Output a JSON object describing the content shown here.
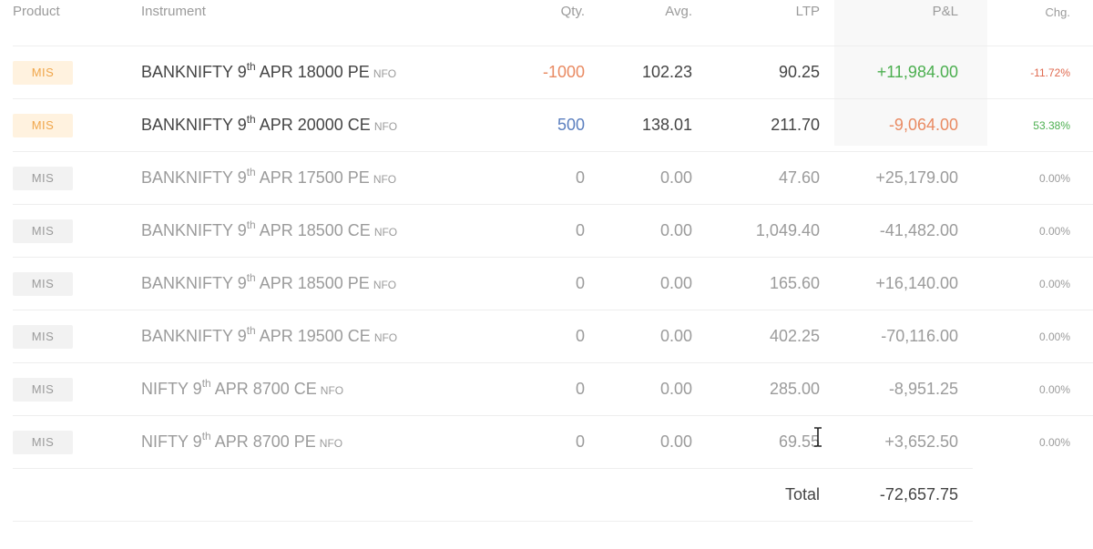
{
  "header": {
    "product": "Product",
    "instrument": "Instrument",
    "qty": "Qty.",
    "avg": "Avg.",
    "ltp": "LTP",
    "pl": "P&L",
    "chg": "Chg."
  },
  "rows": [
    {
      "product": "MIS",
      "inst_pre": "BANKNIFTY 9",
      "inst_sup": "th",
      "inst_post": " APR 18000 PE",
      "exchange": "NFO",
      "qty": "-1000",
      "avg": "102.23",
      "ltp": "90.25",
      "pl": "+11,984.00",
      "chg": "-11.72%"
    },
    {
      "product": "MIS",
      "inst_pre": "BANKNIFTY 9",
      "inst_sup": "th",
      "inst_post": " APR 20000 CE",
      "exchange": "NFO",
      "qty": "500",
      "avg": "138.01",
      "ltp": "211.70",
      "pl": "-9,064.00",
      "chg": "53.38%"
    },
    {
      "product": "MIS",
      "inst_pre": "BANKNIFTY 9",
      "inst_sup": "th",
      "inst_post": " APR 17500 PE",
      "exchange": "NFO",
      "qty": "0",
      "avg": "0.00",
      "ltp": "47.60",
      "pl": "+25,179.00",
      "chg": "0.00%"
    },
    {
      "product": "MIS",
      "inst_pre": "BANKNIFTY 9",
      "inst_sup": "th",
      "inst_post": " APR 18500 CE",
      "exchange": "NFO",
      "qty": "0",
      "avg": "0.00",
      "ltp": "1,049.40",
      "pl": "-41,482.00",
      "chg": "0.00%"
    },
    {
      "product": "MIS",
      "inst_pre": "BANKNIFTY 9",
      "inst_sup": "th",
      "inst_post": " APR 18500 PE",
      "exchange": "NFO",
      "qty": "0",
      "avg": "0.00",
      "ltp": "165.60",
      "pl": "+16,140.00",
      "chg": "0.00%"
    },
    {
      "product": "MIS",
      "inst_pre": "BANKNIFTY 9",
      "inst_sup": "th",
      "inst_post": " APR 19500 CE",
      "exchange": "NFO",
      "qty": "0",
      "avg": "0.00",
      "ltp": "402.25",
      "pl": "-70,116.00",
      "chg": "0.00%"
    },
    {
      "product": "MIS",
      "inst_pre": "NIFTY 9",
      "inst_sup": "th",
      "inst_post": " APR 8700 CE",
      "exchange": "NFO",
      "qty": "0",
      "avg": "0.00",
      "ltp": "285.00",
      "pl": "-8,951.25",
      "chg": "0.00%"
    },
    {
      "product": "MIS",
      "inst_pre": "NIFTY 9",
      "inst_sup": "th",
      "inst_post": " APR 8700 PE",
      "exchange": "NFO",
      "qty": "0",
      "avg": "0.00",
      "ltp": "69.55",
      "pl": "+3,652.50",
      "chg": "0.00%"
    }
  ],
  "footer": {
    "total_label": "Total",
    "total_value": "-72,657.75"
  },
  "colors": {
    "profit": "#4caf50",
    "loss": "#e98a62",
    "badge_open_bg": "#fff2df",
    "badge_open_text": "#f0a64b",
    "badge_closed_bg": "#f2f2f2"
  },
  "icons": {
    "cursor": "text-cursor-icon"
  }
}
